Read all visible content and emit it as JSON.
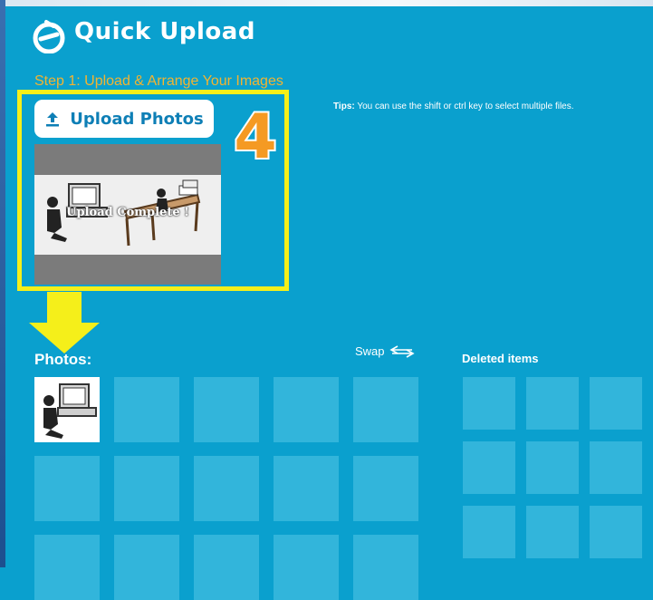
{
  "app": {
    "title": "Quick Upload"
  },
  "step": {
    "heading": "Step 1: Upload & Arrange Your Images"
  },
  "upload": {
    "button_label": "Upload Photos"
  },
  "annotation": {
    "step_number": "4"
  },
  "tips": {
    "label": "Tips:",
    "text": " You can use the shift or ctrl key to select multiple files."
  },
  "preview": {
    "status_text": "Upload Complete !"
  },
  "photos": {
    "label": "Photos:",
    "tile_count": 15,
    "filled_count": 1
  },
  "swap": {
    "label": "Swap"
  },
  "deleted": {
    "label": "Deleted items",
    "tile_count": 9
  },
  "colors": {
    "background": "#0aa0ce",
    "tile": "#32b5db",
    "highlight": "#f5ef1a",
    "step_heading": "#f2b431",
    "step_number": "#f59a23"
  }
}
